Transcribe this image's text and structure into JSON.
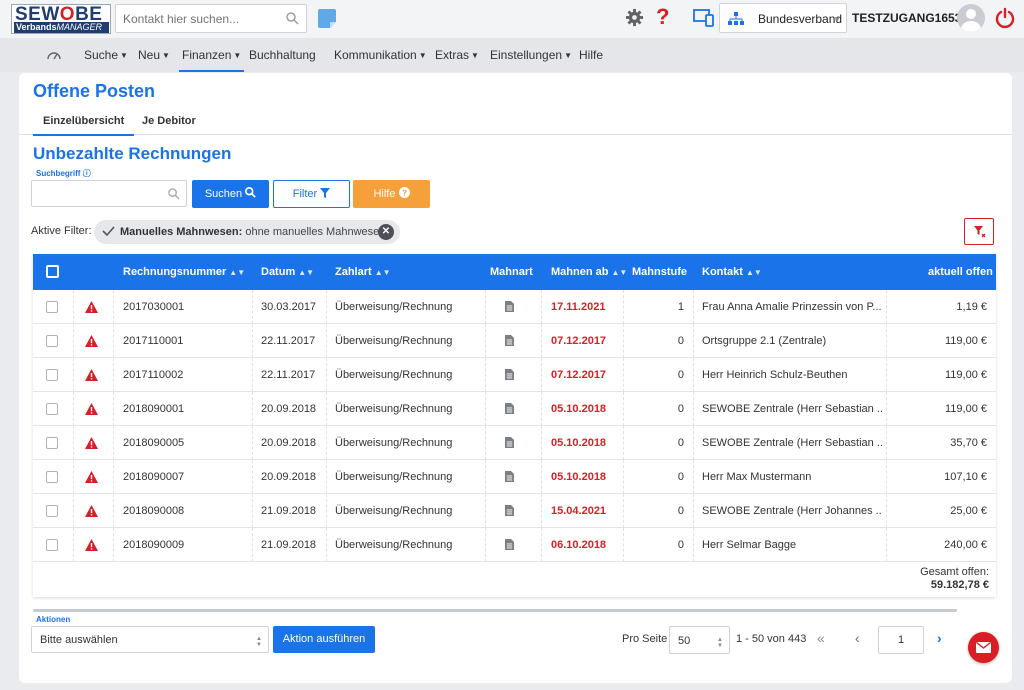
{
  "logo": {
    "line1_a": "SEW",
    "line1_o": "O",
    "line1_b": "BE",
    "line2_a": "Verbands",
    "line2_b": "MANAGER"
  },
  "top": {
    "search_placeholder": "Kontakt hier suchen...",
    "org": "Bundesverband",
    "user": "TESTZUGANG16535",
    "help_glyph": "?"
  },
  "nav": {
    "items": [
      "Suche",
      "Neu",
      "Finanzen",
      "Buchhaltung",
      "Kommunikation",
      "Extras",
      "Einstellungen",
      "Hilfe"
    ],
    "active": "Finanzen"
  },
  "page": {
    "title": "Offene Posten",
    "tabs": [
      "Einzelübersicht",
      "Je Debitor"
    ],
    "active_tab": "Einzelübersicht",
    "section_title": "Unbezahlte Rechnungen",
    "search_label": "Suchbegriff",
    "search_value": "",
    "btn_search": "Suchen",
    "btn_filter": "Filter",
    "btn_help": "Hilfe",
    "active_filter_label": "Aktive Filter:",
    "filter_chip_key": "Manuelles Mahnwesen:",
    "filter_chip_value": "ohne manuelles Mahnwesen"
  },
  "table": {
    "columns": [
      "Rechnungsnummer",
      "Datum",
      "Zahlart",
      "Mahnart",
      "Mahnen ab",
      "Mahnstufe",
      "Kontakt",
      "aktuell offen"
    ],
    "rows": [
      {
        "nr": "2017030001",
        "datum": "30.03.2017",
        "zahlart": "Überweisung/Rechnung",
        "mahnen": "17.11.2021",
        "stufe": "1",
        "kontakt": "Frau Anna Amalie Prinzessin von P...",
        "offen": "1,19 €"
      },
      {
        "nr": "2017110001",
        "datum": "22.11.2017",
        "zahlart": "Überweisung/Rechnung",
        "mahnen": "07.12.2017",
        "stufe": "0",
        "kontakt": "Ortsgruppe 2.1 (Zentrale)",
        "offen": "119,00 €"
      },
      {
        "nr": "2017110002",
        "datum": "22.11.2017",
        "zahlart": "Überweisung/Rechnung",
        "mahnen": "07.12.2017",
        "stufe": "0",
        "kontakt": "Herr Heinrich Schulz-Beuthen",
        "offen": "119,00 €"
      },
      {
        "nr": "2018090001",
        "datum": "20.09.2018",
        "zahlart": "Überweisung/Rechnung",
        "mahnen": "05.10.2018",
        "stufe": "0",
        "kontakt": "SEWOBE Zentrale (Herr Sebastian ...",
        "offen": "119,00 €"
      },
      {
        "nr": "2018090005",
        "datum": "20.09.2018",
        "zahlart": "Überweisung/Rechnung",
        "mahnen": "05.10.2018",
        "stufe": "0",
        "kontakt": "SEWOBE Zentrale (Herr Sebastian ...",
        "offen": "35,70 €"
      },
      {
        "nr": "2018090007",
        "datum": "20.09.2018",
        "zahlart": "Überweisung/Rechnung",
        "mahnen": "05.10.2018",
        "stufe": "0",
        "kontakt": "Herr Max Mustermann",
        "offen": "107,10 €"
      },
      {
        "nr": "2018090008",
        "datum": "21.09.2018",
        "zahlart": "Überweisung/Rechnung",
        "mahnen": "15.04.2021",
        "stufe": "0",
        "kontakt": "SEWOBE Zentrale (Herr Johannes ...",
        "offen": "25,00 €"
      },
      {
        "nr": "2018090009",
        "datum": "21.09.2018",
        "zahlart": "Überweisung/Rechnung",
        "mahnen": "06.10.2018",
        "stufe": "0",
        "kontakt": "Herr Selmar Bagge",
        "offen": "240,00 €"
      }
    ],
    "total_label": "Gesamt offen:",
    "total_value": "59.182,78 €"
  },
  "bottom": {
    "actions_label": "Aktionen",
    "actions_select": "Bitte auswählen",
    "btn_execute": "Aktion ausführen",
    "per_page_label": "Pro Seite",
    "per_page": "50",
    "range": "1 - 50 von 443",
    "page": "1"
  },
  "colors": {
    "accent": "#1a73e8",
    "danger": "#d81f26",
    "help": "#f6a03c"
  }
}
